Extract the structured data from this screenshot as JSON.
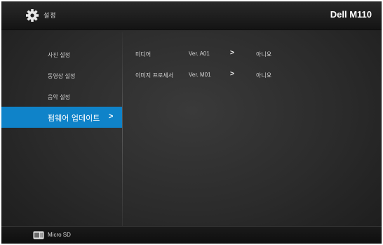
{
  "header": {
    "title": "설정",
    "model": "Dell M110",
    "gear_icon": "gear-icon"
  },
  "sidebar": {
    "items": [
      {
        "label": "사진 설정",
        "active": false
      },
      {
        "label": "동영상 설정",
        "active": false
      },
      {
        "label": "음악 설정",
        "active": false
      },
      {
        "label": "펌웨어 업데이트",
        "active": true
      }
    ],
    "active_color": "#0f83c9"
  },
  "firmware": {
    "rows": [
      {
        "name": "미디어",
        "version": "Ver. A01",
        "arrow": ">",
        "value": "아니요"
      },
      {
        "name": "이미지 프로세서",
        "version": "Ver. M01",
        "arrow": ">",
        "value": "아니요"
      }
    ]
  },
  "footer": {
    "storage_label": "Micro SD",
    "storage_icon": "sd-card-icon"
  }
}
